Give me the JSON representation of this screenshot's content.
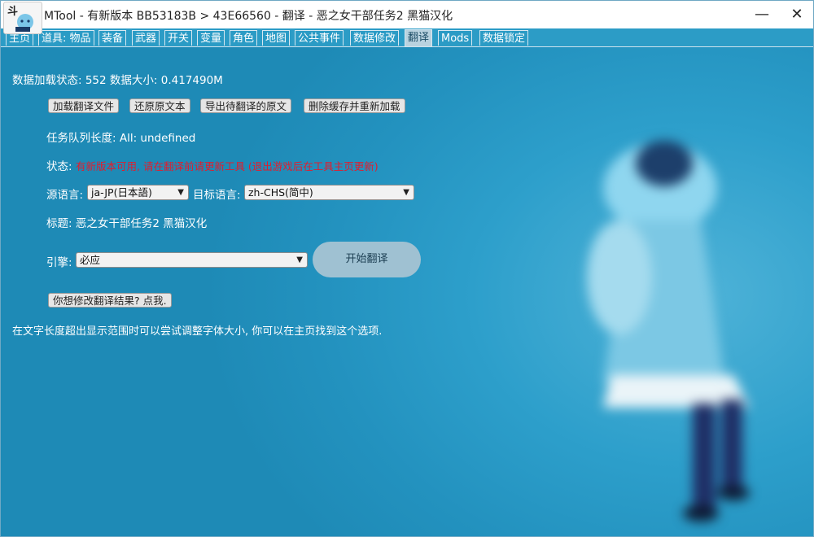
{
  "window": {
    "title": "MTool - 有新版本 BB53183B > 43E66560 - 翻译 - 恶之女干部任务2 黑猫汉化",
    "icon_text": "斗",
    "minimize_label": "—",
    "close_label": "✕"
  },
  "tabs": [
    {
      "label": "主页",
      "active": false
    },
    {
      "label": "道具: 物品",
      "active": false
    },
    {
      "label": "装备",
      "active": false
    },
    {
      "label": "武器",
      "active": false
    },
    {
      "label": "开关",
      "active": false
    },
    {
      "label": "变量",
      "active": false
    },
    {
      "label": "角色",
      "active": false
    },
    {
      "label": "地图",
      "active": false
    },
    {
      "label": "公共事件",
      "active": false
    },
    {
      "label": "数据修改",
      "active": false
    },
    {
      "label": "翻译",
      "active": true
    },
    {
      "label": "Mods",
      "active": false
    },
    {
      "label": "数据锁定",
      "active": false
    }
  ],
  "translate": {
    "load_status": "数据加载状态: 552 数据大小: 0.417490M",
    "buttons": {
      "load_file": "加载翻译文件",
      "restore": "还原原文本",
      "export": "导出待翻译的原文",
      "clear_cache": "删除缓存并重新加载"
    },
    "queue_length": "任务队列长度: All: undefined",
    "status_label": "状态:",
    "status_message": "有新版本可用, 请在翻译前请更新工具 (退出游戏后在工具主页更新)",
    "source_lang_label": "源语言:",
    "source_lang_value": "ja-JP(日本語)",
    "target_lang_label": "目标语言:",
    "target_lang_value": "zh-CHS(简中)",
    "title_line": "标题: 恶之女干部任务2 黑猫汉化",
    "engine_label": "引擎:",
    "engine_value": "必应",
    "start_button": "开始翻译",
    "modify_button": "你想修改翻译结果? 点我.",
    "tip": "在文字长度超出显示范围时可以尝试调整字体大小, 你可以在主页找到这个选项."
  }
}
